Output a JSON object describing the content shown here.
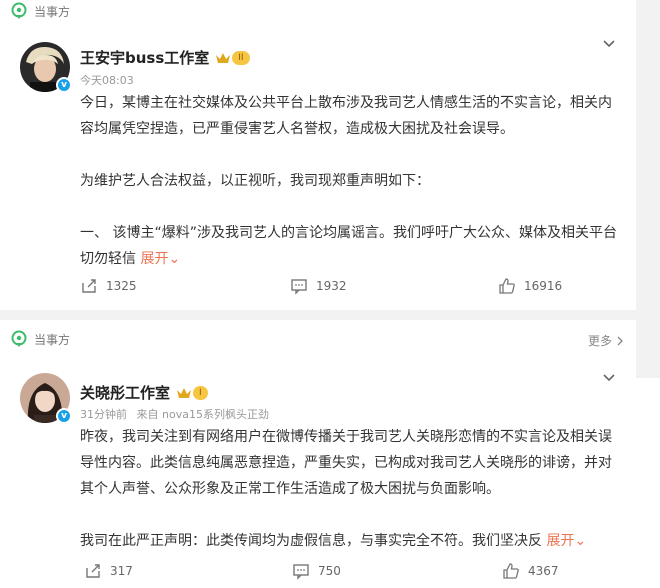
{
  "posts": [
    {
      "header_label": "当事方",
      "author": "王安宇buss工作室",
      "rank": "II",
      "time": "今天08:03",
      "source": "",
      "paragraphs": [
        "今日，某博主在社交媒体及公共平台上散布涉及我司艺人情感生活的不实言论，相关内容均属凭空捏造，已严重侵害艺人名誉权，造成极大困扰及社会误导。",
        "为维护艺人合法权益，以正视听，我司现郑重声明如下：",
        "一、 该博主“爆料”涉及我司艺人的言论均属谣言。我们呼吁广大公众、媒体及相关平台切勿轻信"
      ],
      "expand_label": "展开",
      "repost": "1325",
      "comment": "1932",
      "like": "16916"
    },
    {
      "header_label": "当事方",
      "more_label": "更多",
      "author": "关晓彤工作室",
      "rank": "I",
      "time": "31分钟前",
      "source": "来自 nova15系列枫头正劲",
      "paragraphs": [
        "昨夜，我司关注到有网络用户在微博传播关于我司艺人关晓彤恋情的不实言论及相关误导性内容。此类信息纯属恶意捏造，严重失实，已构成对我司艺人关晓彤的诽谤，并对其个人声誉、公众形象及正常工作生活造成了极大困扰与负面影响。",
        "我司在此严正声明：此类传闻均为虚假信息，与事实完全不符。我们坚决反"
      ],
      "expand_label": "展开",
      "repost": "317",
      "comment": "750",
      "like": "4367"
    }
  ],
  "colors": {
    "accent": "#eb7350",
    "verified": "#1aa0e8",
    "green": "#3dbb6c"
  },
  "icons": [
    "location-pin-icon",
    "chevron-down-icon",
    "chevron-right-icon",
    "repost-icon",
    "comment-icon",
    "like-icon",
    "verified-icon",
    "crown-icon"
  ]
}
